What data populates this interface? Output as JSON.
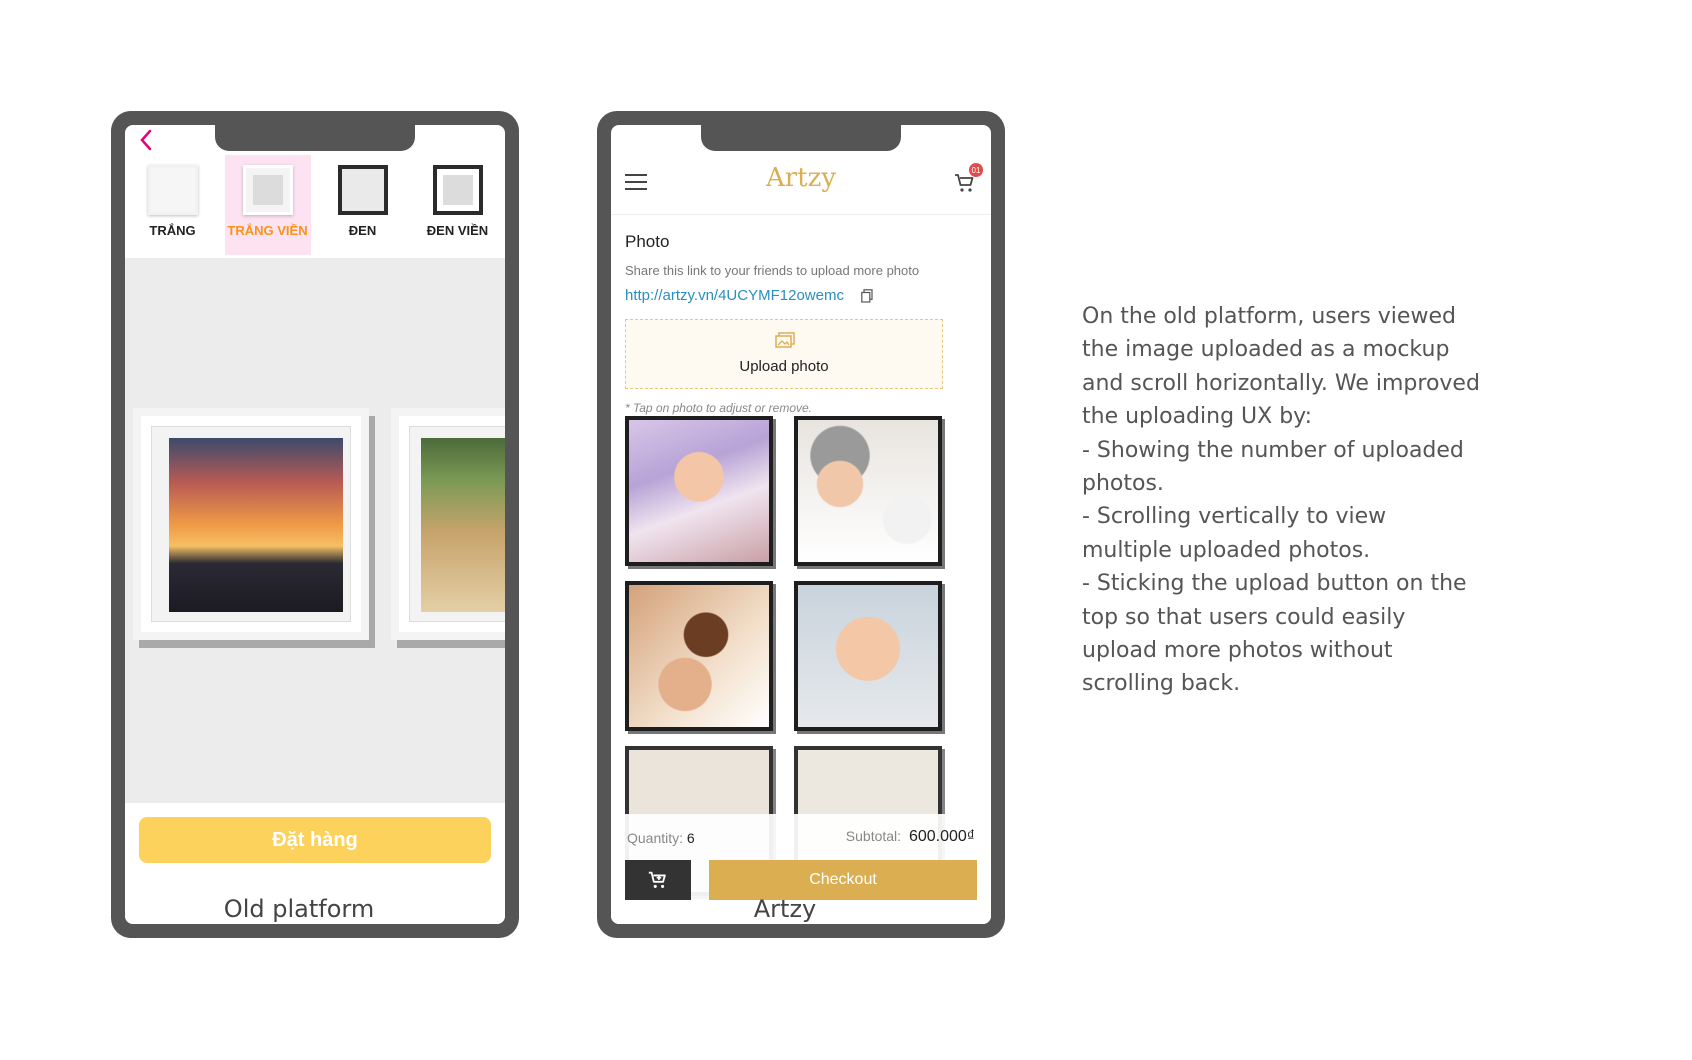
{
  "old_platform": {
    "frame_options": [
      {
        "label": "TRẮNG",
        "selected": false
      },
      {
        "label": "TRẮNG VIỀN",
        "selected": true
      },
      {
        "label": "ĐEN",
        "selected": false
      },
      {
        "label": "ĐEN VIỀN",
        "selected": false
      }
    ],
    "order_button": "Đặt hàng",
    "caption": "Old platform",
    "colors": {
      "accent": "#f7931e",
      "back": "#e6007e",
      "button": "#fcd15c"
    }
  },
  "artzy": {
    "logo": "Artzy",
    "cart_badge": "01",
    "section_title": "Photo",
    "share_text": "Share this link to your friends to upload more photo",
    "share_link": "http://artzy.vn/4UCYMF12owemc",
    "upload_label": "Upload photo",
    "tap_hint": "* Tap on photo to adjust or remove.",
    "quantity_label": "Quantity:",
    "quantity_value": "6",
    "subtotal_label": "Subtotal:",
    "subtotal_value": "600.000₫",
    "checkout_label": "Checkout",
    "caption": "Artzy",
    "colors": {
      "brand": "#dcae52",
      "link": "#2a8fbd"
    }
  },
  "description": {
    "lines": [
      "On the old platform, users viewed the image uploaded as a mockup and scroll horizontally. We improved the uploading UX by:",
      "- Showing the number of uploaded photos.",
      "- Scrolling vertically to view multiple uploaded photos.",
      "- Sticking the upload button on the top so that users could easily upload more photos without scrolling back."
    ]
  }
}
